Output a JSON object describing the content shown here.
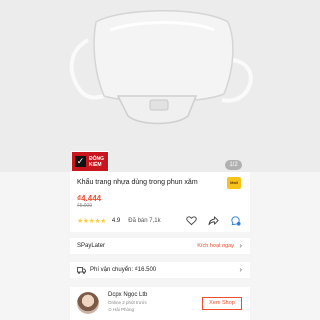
{
  "gallery": {
    "badge_line1": "ĐÓNG",
    "badge_line2": "KIỂM",
    "counter": "1/2"
  },
  "product": {
    "title": "Khẩu trang nhựa dùng trong phun xăm",
    "mall_badge": "Mall",
    "price": "₫4.444",
    "original_price": "₫5.900",
    "rating": "4.9",
    "stars_filled": 4.5,
    "sold": "Đã bán 7,1k"
  },
  "actions": {
    "icons": [
      "heart-icon",
      "share-icon",
      "chat-icon"
    ]
  },
  "spaylater": {
    "label": "SPayLater",
    "link": "Kích hoạt ngay"
  },
  "shipping": {
    "label": "Phí vận chuyển: ₫16.500"
  },
  "shop": {
    "name": "Dcpx Ngọc Ltb",
    "online": "Online 2 phút trước",
    "location": "Hải Phòng",
    "button": "Xem Shop"
  },
  "colors": {
    "accent": "#ee4d2d",
    "badge_red": "#c9151d",
    "star": "#ffce3d"
  }
}
